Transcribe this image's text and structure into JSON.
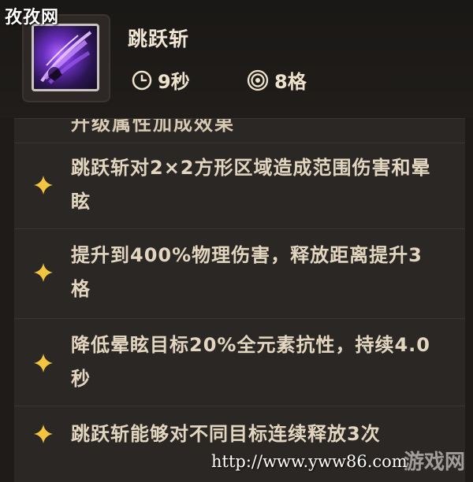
{
  "watermark_top": "孜孜网",
  "skill": {
    "icon": "purple-slash-skill-icon",
    "name": "跳跃斩",
    "cooldown": "9秒",
    "range": "8格"
  },
  "panel": {
    "cut_line": "升级属性加成效果",
    "effects": [
      {
        "icon": "gold-star-icon",
        "text": "跳跃斩对2×2方形区域造成范围伤害和晕眩"
      },
      {
        "icon": "gold-star-icon",
        "text": "提升到400%物理伤害，释放距离提升3格"
      },
      {
        "icon": "gold-star-icon",
        "text": "降低晕眩目标20%全元素抗性，持续4.0秒"
      },
      {
        "icon": "gold-star-icon",
        "text": "跳跃斩能够对不同目标连续释放3次"
      }
    ]
  },
  "watermark_bottom": "http://www.yww86.com",
  "watermark_logo": "游戏网",
  "colors": {
    "background": "#1e1b19",
    "panel": "#2b2724",
    "text": "#e3d6c0",
    "star": "#f2c440"
  }
}
